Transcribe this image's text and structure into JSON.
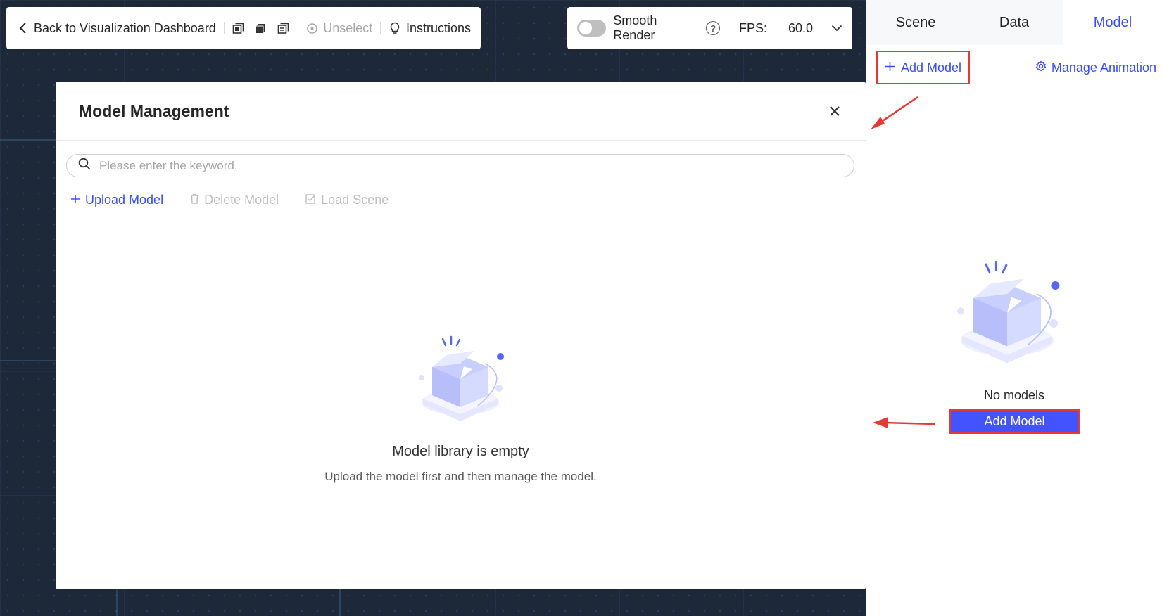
{
  "toolbar_left": {
    "back_label": "Back to Visualization Dashboard",
    "view_icons": [
      "front-view-icon",
      "solid-cube-icon",
      "layers-view-icon"
    ],
    "unselect_label": "Unselect",
    "instructions_label": "Instructions"
  },
  "toolbar_right": {
    "smooth_render_label": "Smooth Render",
    "smooth_render_on": false,
    "fps_label": "FPS:",
    "fps_value": "60.0"
  },
  "modal": {
    "title": "Model Management",
    "search_placeholder": "Please enter the keyword.",
    "search_value": "",
    "actions": {
      "upload": "Upload Model",
      "delete": "Delete Model",
      "load_scene": "Load Scene"
    },
    "empty_title": "Model library is empty",
    "empty_subtitle": "Upload the model first and then manage the model."
  },
  "right_panel": {
    "tabs": [
      "Scene",
      "Data",
      "Model"
    ],
    "active_tab": "Model",
    "add_model_link": "Add Model",
    "manage_animation": "Manage Animation",
    "empty_text": "No models",
    "add_model_button": "Add Model"
  },
  "colors": {
    "accent": "#3b4ef5",
    "button_bg": "#4353ff",
    "highlight_border": "#e53935",
    "canvas_bg": "#1d2939"
  }
}
